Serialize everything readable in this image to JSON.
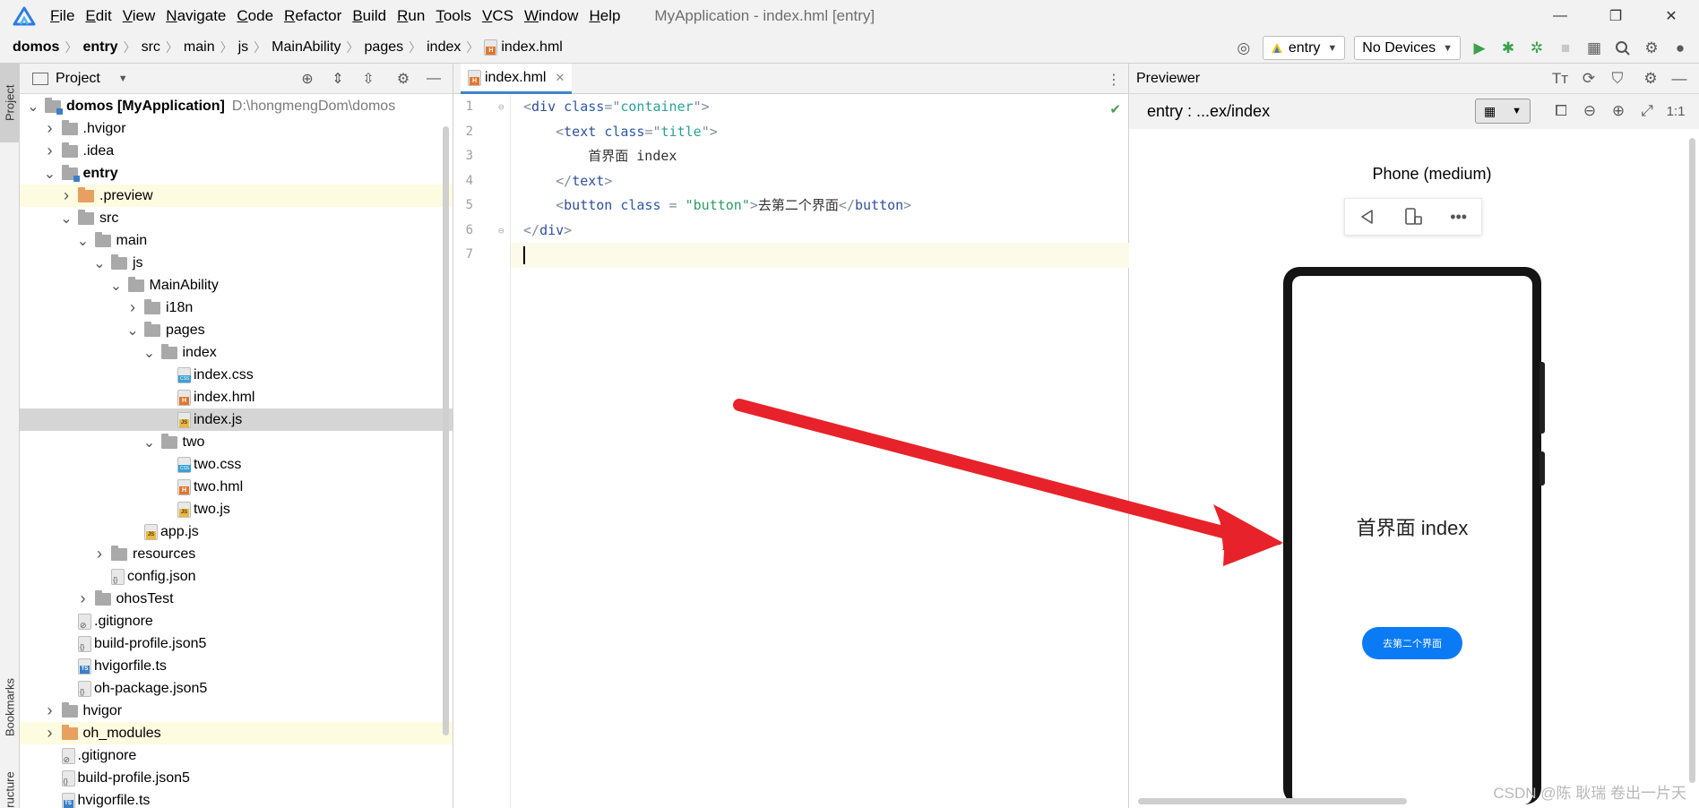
{
  "menubar": {
    "items": [
      {
        "mnemonic": "F",
        "rest": "ile"
      },
      {
        "mnemonic": "E",
        "rest": "dit"
      },
      {
        "mnemonic": "V",
        "rest": "iew"
      },
      {
        "mnemonic": "N",
        "rest": "avigate"
      },
      {
        "mnemonic": "C",
        "rest": "ode"
      },
      {
        "mnemonic": "R",
        "rest": "efactor"
      },
      {
        "mnemonic": "B",
        "rest": "uild"
      },
      {
        "mnemonic": "R",
        "rest": "un"
      },
      {
        "mnemonic": "T",
        "rest": "ools"
      },
      {
        "mnemonic": "V",
        "rest": "CS"
      },
      {
        "mnemonic": "W",
        "rest": "indow"
      },
      {
        "mnemonic": "H",
        "rest": "elp"
      }
    ],
    "window_title": "MyApplication - index.hml [entry]",
    "controls": {
      "minimize": "—",
      "maximize": "❐",
      "close": "✕"
    }
  },
  "navbar": {
    "crumbs": [
      "domos",
      "entry",
      "src",
      "main",
      "js",
      "MainAbility",
      "pages",
      "index"
    ],
    "file": "index.hml",
    "run_config": "entry",
    "device": "No Devices"
  },
  "left_strip": {
    "project_tab": "Project",
    "bookmarks_tab": "Bookmarks",
    "structure_tab": "Structure"
  },
  "project_panel": {
    "title": "Project",
    "tree": [
      {
        "indent": 0,
        "chev": "v",
        "icon": "module",
        "label": "domos [MyApplication]",
        "bold": true,
        "path": "D:\\hongmengDom\\domos"
      },
      {
        "indent": 1,
        "chev": ">",
        "icon": "folder",
        "label": ".hvigor"
      },
      {
        "indent": 1,
        "chev": ">",
        "icon": "folder",
        "label": ".idea"
      },
      {
        "indent": 1,
        "chev": "v",
        "icon": "module",
        "label": "entry",
        "bold": true
      },
      {
        "indent": 2,
        "chev": ">",
        "icon": "folder-orange",
        "label": ".preview",
        "highlight": true
      },
      {
        "indent": 2,
        "chev": "v",
        "icon": "folder",
        "label": "src"
      },
      {
        "indent": 3,
        "chev": "v",
        "icon": "folder",
        "label": "main"
      },
      {
        "indent": 4,
        "chev": "v",
        "icon": "folder",
        "label": "js"
      },
      {
        "indent": 5,
        "chev": "v",
        "icon": "folder",
        "label": "MainAbility"
      },
      {
        "indent": 6,
        "chev": ">",
        "icon": "folder",
        "label": "i18n"
      },
      {
        "indent": 6,
        "chev": "v",
        "icon": "folder",
        "label": "pages"
      },
      {
        "indent": 7,
        "chev": "v",
        "icon": "folder",
        "label": "index"
      },
      {
        "indent": 8,
        "chev": "",
        "icon": "css",
        "label": "index.css"
      },
      {
        "indent": 8,
        "chev": "",
        "icon": "html",
        "label": "index.hml"
      },
      {
        "indent": 8,
        "chev": "",
        "icon": "js",
        "label": "index.js",
        "selected": true
      },
      {
        "indent": 7,
        "chev": "v",
        "icon": "folder",
        "label": "two"
      },
      {
        "indent": 8,
        "chev": "",
        "icon": "css",
        "label": "two.css"
      },
      {
        "indent": 8,
        "chev": "",
        "icon": "html",
        "label": "two.hml"
      },
      {
        "indent": 8,
        "chev": "",
        "icon": "js",
        "label": "two.js"
      },
      {
        "indent": 6,
        "chev": "",
        "icon": "js",
        "label": "app.js"
      },
      {
        "indent": 4,
        "chev": ">",
        "icon": "folder",
        "label": "resources"
      },
      {
        "indent": 4,
        "chev": "",
        "icon": "json",
        "label": "config.json"
      },
      {
        "indent": 3,
        "chev": ">",
        "icon": "folder",
        "label": "ohosTest"
      },
      {
        "indent": 2,
        "chev": "",
        "icon": "git",
        "label": ".gitignore"
      },
      {
        "indent": 2,
        "chev": "",
        "icon": "json",
        "label": "build-profile.json5"
      },
      {
        "indent": 2,
        "chev": "",
        "icon": "ts",
        "label": "hvigorfile.ts"
      },
      {
        "indent": 2,
        "chev": "",
        "icon": "json",
        "label": "oh-package.json5"
      },
      {
        "indent": 1,
        "chev": ">",
        "icon": "folder",
        "label": "hvigor"
      },
      {
        "indent": 1,
        "chev": ">",
        "icon": "folder-orange",
        "label": "oh_modules",
        "highlight": true
      },
      {
        "indent": 1,
        "chev": "",
        "icon": "git",
        "label": ".gitignore"
      },
      {
        "indent": 1,
        "chev": "",
        "icon": "json",
        "label": "build-profile.json5"
      },
      {
        "indent": 1,
        "chev": "",
        "icon": "ts",
        "label": "hvigorfile.ts"
      }
    ]
  },
  "editor": {
    "tab_label": "index.hml",
    "lines": [
      {
        "no": "1",
        "parts": [
          [
            "br",
            "<"
          ],
          [
            "tag",
            "div "
          ],
          [
            "attr",
            "class"
          ],
          [
            "br",
            "=\""
          ],
          [
            "val",
            "container"
          ],
          [
            "br",
            "\">"
          ]
        ]
      },
      {
        "no": "2",
        "parts": [
          [
            "sp",
            "    "
          ],
          [
            "br",
            "<"
          ],
          [
            "tag",
            "text "
          ],
          [
            "attr",
            "class"
          ],
          [
            "br",
            "=\""
          ],
          [
            "val",
            "title"
          ],
          [
            "br",
            "\">"
          ]
        ]
      },
      {
        "no": "3",
        "parts": [
          [
            "sp",
            "        "
          ],
          [
            "text",
            "首界面 index"
          ]
        ]
      },
      {
        "no": "4",
        "parts": [
          [
            "sp",
            "    "
          ],
          [
            "br",
            "</"
          ],
          [
            "tag",
            "text"
          ],
          [
            "br",
            ">"
          ]
        ]
      },
      {
        "no": "5",
        "parts": [
          [
            "sp",
            "    "
          ],
          [
            "br",
            "<"
          ],
          [
            "tag",
            "button "
          ],
          [
            "attr",
            "class"
          ],
          [
            "br",
            " = "
          ],
          [
            "str",
            "\"button\""
          ],
          [
            "br",
            ">"
          ],
          [
            "text",
            "去第二个界面"
          ],
          [
            "br",
            "</"
          ],
          [
            "tag",
            "button"
          ],
          [
            "br",
            ">"
          ]
        ]
      },
      {
        "no": "6",
        "parts": [
          [
            "br",
            "</"
          ],
          [
            "tag",
            "div"
          ],
          [
            "br",
            ">"
          ]
        ]
      },
      {
        "no": "7",
        "parts": []
      }
    ]
  },
  "previewer": {
    "title": "Previewer",
    "path": "entry : ...ex/index",
    "zoom_reset": "1:1",
    "device_name": "Phone (medium)",
    "screen_title": "首界面 index",
    "screen_button": "去第二个界面"
  },
  "watermark": "CSDN @陈 耿瑞 卷出一片天",
  "colors": {
    "accent": "#4083c9",
    "phone_button": "#0a7bf5",
    "arrow": "#e8222a"
  }
}
